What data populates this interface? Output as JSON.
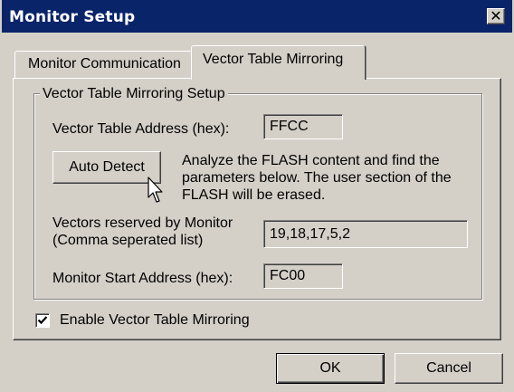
{
  "window": {
    "title": "Monitor Setup",
    "close_glyph": "✕"
  },
  "tabs": [
    {
      "label": "Monitor Communication",
      "selected": false
    },
    {
      "label": "Vector Table Mirroring",
      "selected": true
    }
  ],
  "group": {
    "title": "Vector Table Mirroring Setup",
    "vector_table_address": {
      "label": "Vector Table Address (hex):",
      "value": "FFCC"
    },
    "auto_detect": {
      "button_label": "Auto Detect",
      "description": [
        "Analyze the FLASH content and find the",
        "parameters below. The user section of the",
        "FLASH will be erased."
      ]
    },
    "vectors_reserved": {
      "label_line1": "Vectors reserved by Monitor",
      "label_line2": "(Comma seperated list)",
      "value": "19,18,17,5,2"
    },
    "monitor_start_address": {
      "label": "Monitor Start Address (hex):",
      "value": "FC00"
    }
  },
  "enable_mirroring": {
    "label": "Enable Vector Table Mirroring",
    "checked": true
  },
  "buttons": {
    "ok": "OK",
    "cancel": "Cancel"
  },
  "icons": {
    "close": "close-icon",
    "check": "check-icon",
    "cursor": "mouse-cursor-icon"
  },
  "colors": {
    "titlebar": "#0a246a",
    "face": "#d4d0c8"
  }
}
